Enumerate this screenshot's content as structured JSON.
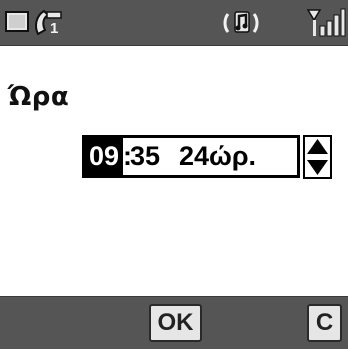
{
  "status_bar": {
    "icons": [
      "message-icon",
      "line-1-icon",
      "ringer-icon",
      "signal-strength-icon"
    ],
    "line_number": "1",
    "background": "#555555"
  },
  "screen": {
    "title": "Ώρα"
  },
  "time_field": {
    "hour": "09",
    "separator": ":",
    "minutes": "35",
    "mode": "24ώρ."
  },
  "softkeys": {
    "ok_label": "OK",
    "clear_label": "C"
  }
}
